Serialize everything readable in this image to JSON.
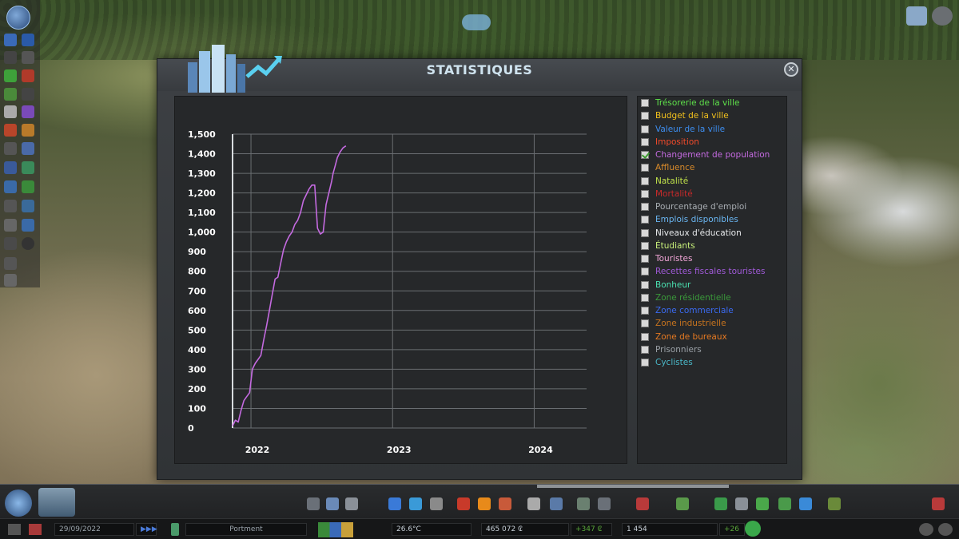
{
  "window": {
    "title": "STATISTIQUES",
    "close_label": "✕"
  },
  "chart_data": {
    "type": "line",
    "title": "",
    "xlabel": "",
    "ylabel": "",
    "ylim": [
      0,
      1500
    ],
    "y_ticks": [
      "0",
      "100",
      "200",
      "300",
      "400",
      "500",
      "600",
      "700",
      "800",
      "900",
      "1,000",
      "1,100",
      "1,200",
      "1,300",
      "1,400",
      "1,500"
    ],
    "y_tick_values": [
      0,
      100,
      200,
      300,
      400,
      500,
      600,
      700,
      800,
      900,
      1000,
      1100,
      1200,
      1300,
      1400,
      1500
    ],
    "x_ticks": [
      "2022",
      "2023",
      "2024"
    ],
    "x_tick_values": [
      2022,
      2023,
      2024
    ],
    "xlim": [
      2021.87,
      2024.37
    ],
    "grid": true,
    "series": [
      {
        "color": "#c46ae0",
        "x": [
          2021.87,
          2021.89,
          2021.91,
          2021.93,
          2021.95,
          2021.97,
          2021.99,
          2022.01,
          2022.03,
          2022.05,
          2022.07,
          2022.09,
          2022.11,
          2022.13,
          2022.15,
          2022.17,
          2022.19,
          2022.21,
          2022.23,
          2022.25,
          2022.27,
          2022.29,
          2022.31,
          2022.33,
          2022.35,
          2022.37,
          2022.39,
          2022.41,
          2022.43,
          2022.45,
          2022.47,
          2022.49,
          2022.51,
          2022.53,
          2022.55,
          2022.57,
          2022.58,
          2022.595,
          2022.61,
          2022.63,
          2022.65,
          2022.67
        ],
        "values": [
          10,
          40,
          30,
          90,
          140,
          160,
          180,
          300,
          330,
          350,
          370,
          450,
          520,
          600,
          680,
          760,
          770,
          840,
          910,
          950,
          980,
          1000,
          1040,
          1060,
          1100,
          1160,
          1190,
          1220,
          1240,
          1240,
          1020,
          990,
          1000,
          1140,
          1200,
          1260,
          1300,
          1340,
          1380,
          1410,
          1430,
          1440
        ]
      }
    ]
  },
  "legend": {
    "items": [
      {
        "label": "Trésorerie de la ville",
        "color": "#5ee04a",
        "checked": false
      },
      {
        "label": "Budget de la ville",
        "color": "#f2c11d",
        "checked": false
      },
      {
        "label": "Valeur de la ville",
        "color": "#3d8ef0",
        "checked": false
      },
      {
        "label": "Imposition",
        "color": "#f24a2a",
        "checked": false
      },
      {
        "label": "Changement de population",
        "color": "#c46ae0",
        "checked": true
      },
      {
        "label": "Affluence",
        "color": "#d88a2a",
        "checked": false
      },
      {
        "label": "Natalité",
        "color": "#bfe04a",
        "checked": false
      },
      {
        "label": "Mortalité",
        "color": "#c82a2a",
        "checked": false
      },
      {
        "label": "Pourcentage d'emploi",
        "color": "#a8adb2",
        "checked": false
      },
      {
        "label": "Emplois disponibles",
        "color": "#6ab6f2",
        "checked": false
      },
      {
        "label": "Niveaux d'éducation",
        "color": "#e8eaec",
        "checked": false
      },
      {
        "label": "Étudiants",
        "color": "#c8f07a",
        "checked": false
      },
      {
        "label": "Touristes",
        "color": "#f2a6d8",
        "checked": false
      },
      {
        "label": "Recettes fiscales touristes",
        "color": "#a05ad8",
        "checked": false
      },
      {
        "label": "Bonheur",
        "color": "#4ae0b0",
        "checked": false
      },
      {
        "label": "Zone résidentielle",
        "color": "#3a9a3a",
        "checked": false
      },
      {
        "label": "Zone commerciale",
        "color": "#3a6af0",
        "checked": false
      },
      {
        "label": "Zone industrielle",
        "color": "#c8741e",
        "checked": false
      },
      {
        "label": "Zone de bureaux",
        "color": "#e67a22",
        "checked": false
      },
      {
        "label": "Prisonniers",
        "color": "#9aa0a6",
        "checked": false
      },
      {
        "label": "Cyclistes",
        "color": "#4ab8c8",
        "checked": false
      }
    ]
  },
  "bottom_bar": {
    "date": "29/09/2022",
    "speed": "▶▶▶",
    "district": "Portment",
    "temperature": "26.6°C",
    "money": "465 072 ₢",
    "income": "+347 ₢",
    "population": "1 454",
    "pop_change": "+26"
  },
  "colors": {
    "accent": "#cfe3ef",
    "chart_line": "#c46ae0",
    "grid": "#6a6e72"
  }
}
